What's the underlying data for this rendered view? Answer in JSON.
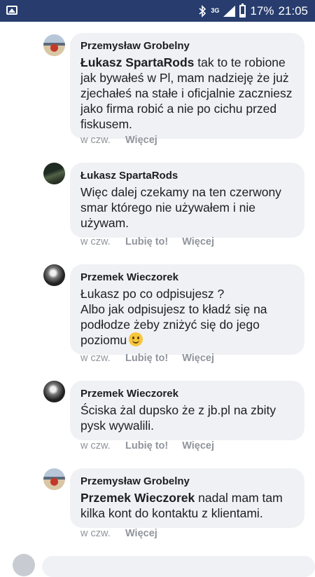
{
  "status_bar": {
    "network": "3G",
    "battery": "17%",
    "time": "21:05",
    "icons": [
      "gallery-icon",
      "bluetooth-icon",
      "signal-icon",
      "battery-icon"
    ]
  },
  "comments": [
    {
      "author": "Przemysław Grobelny",
      "mention": "Łukasz SpartaRods",
      "text": " tak to te robione jak bywałeś w Pl, mam nadzieję że już zjechałeś na stałe i oficjalnie zaczniesz jako firma robić a nie po cichu przed fiskusem.",
      "time": "w czw.",
      "like": "",
      "more": "Więcej"
    },
    {
      "author": "Łukasz SpartaRods",
      "mention": "",
      "text": "Więc dalej czekamy na ten czerwony smar którego nie używałem i nie używam.",
      "time": "w czw.",
      "like": "Lubię to!",
      "more": "Więcej"
    },
    {
      "author": "Przemek Wieczorek",
      "mention": "",
      "text": "Łukasz po co odpisujesz ?\nAlbo jak odpisujesz to kładź się na podłodze żeby zniżyć się do jego poziomu",
      "emoji": "slightly-smiling-face",
      "time": "w czw.",
      "like": "Lubię to!",
      "more": "Więcej"
    },
    {
      "author": "Przemek Wieczorek",
      "mention": "",
      "text": "Ściska żal dupsko że z jb.pl na zbity pysk wywalili.",
      "time": "w czw.",
      "like": "Lubię to!",
      "more": "Więcej"
    },
    {
      "author": "Przemysław Grobelny",
      "mention": "Przemek Wieczorek",
      "text": " nadal mam tam kilka kont do kontaktu z klientami.",
      "time": "w czw.",
      "like": "",
      "more": "Więcej"
    }
  ]
}
